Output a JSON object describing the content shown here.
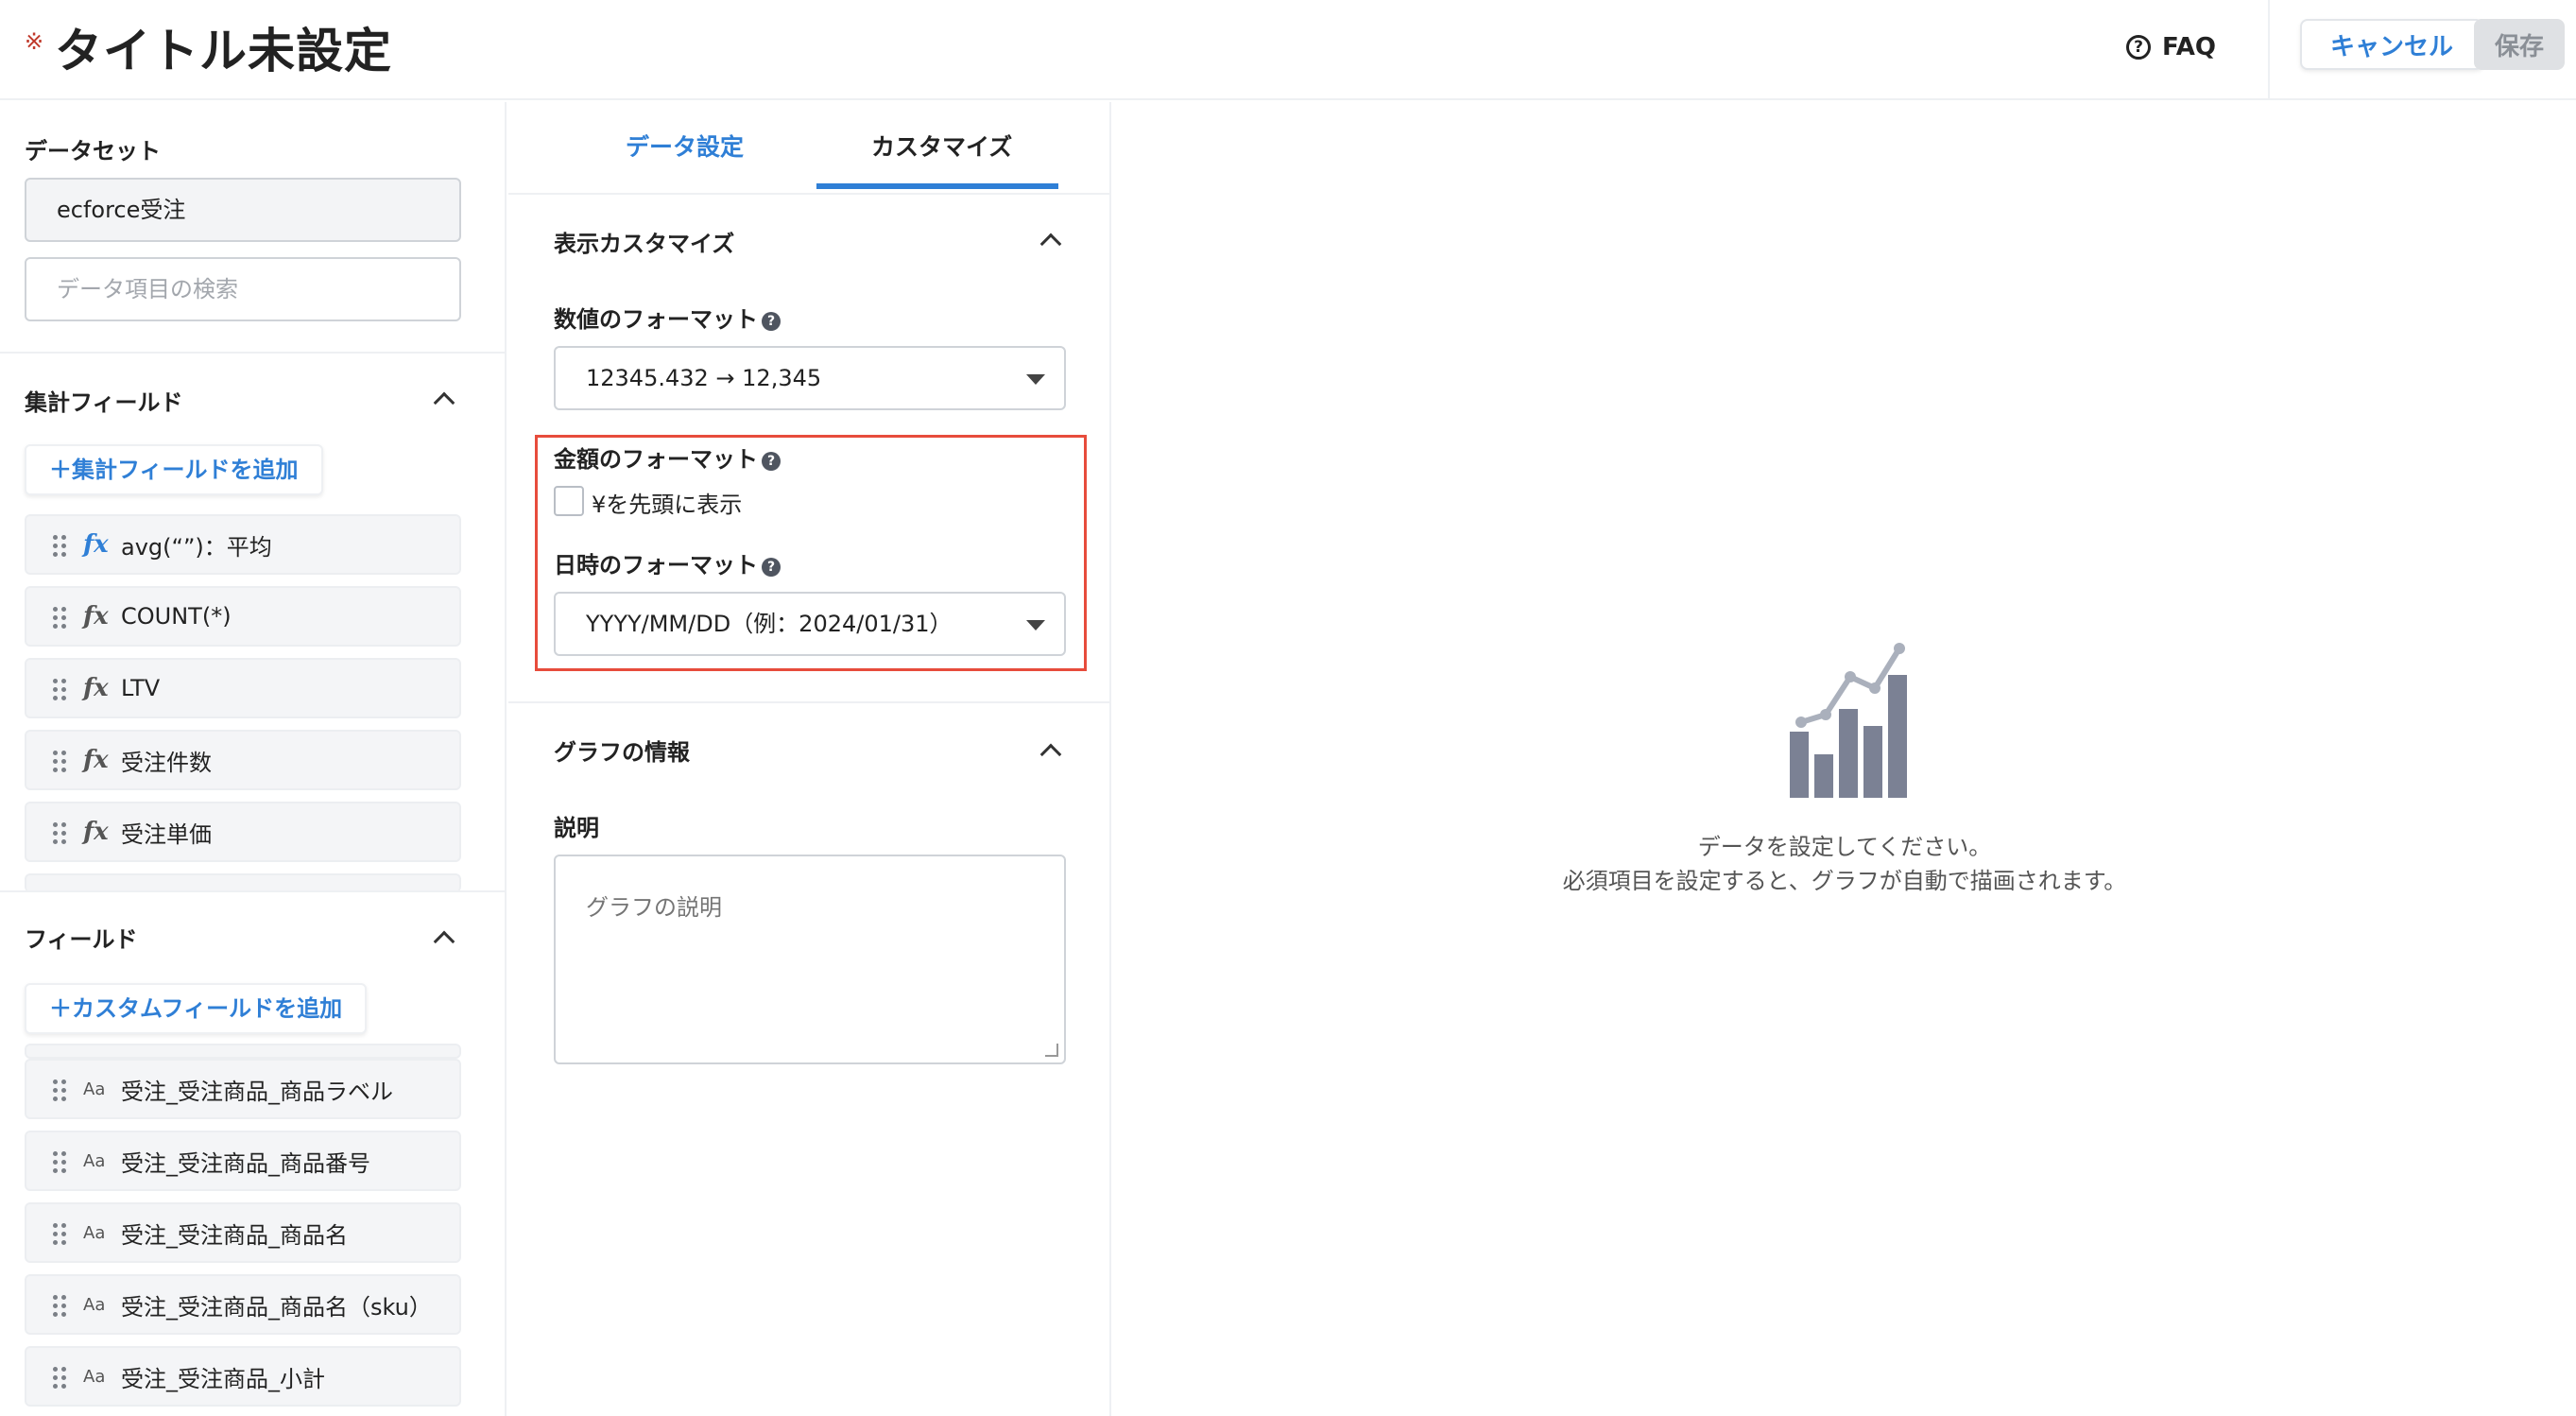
{
  "header": {
    "title_mark": "※",
    "title": "タイトル未設定",
    "faq_label": "FAQ",
    "cancel_label": "キャンセル",
    "save_label": "保存"
  },
  "left": {
    "dataset_label": "データセット",
    "dataset_value": "ecforce受注",
    "search_placeholder": "データ項目の検索",
    "aggregate_section": {
      "title": "集計フィールド",
      "add_label": "＋集計フィールドを追加",
      "items": [
        {
          "label": "avg(“”)：平均",
          "icon": "fx"
        },
        {
          "label": "COUNT(*)",
          "icon": "fx"
        },
        {
          "label": "LTV",
          "icon": "fx"
        },
        {
          "label": "受注件数",
          "icon": "fx"
        },
        {
          "label": "受注単価",
          "icon": "fx"
        }
      ]
    },
    "field_section": {
      "title": "フィールド",
      "add_label": "＋カスタムフィールドを追加",
      "items": [
        {
          "label": "受注_受注商品_商品ラベル",
          "icon": "Aa"
        },
        {
          "label": "受注_受注商品_商品番号",
          "icon": "Aa"
        },
        {
          "label": "受注_受注商品_商品名",
          "icon": "Aa"
        },
        {
          "label": "受注_受注商品_商品名（sku）",
          "icon": "Aa"
        },
        {
          "label": "受注_受注商品_小計",
          "icon": "Aa"
        }
      ]
    }
  },
  "mid": {
    "tabs": [
      {
        "label": "データ設定",
        "active": false
      },
      {
        "label": "カスタマイズ",
        "active": true
      }
    ],
    "display_section": {
      "title": "表示カスタマイズ",
      "number_format_label": "数値のフォーマット",
      "number_format_value": "12345.432 → 12,345",
      "currency_format_label": "金額のフォーマット",
      "currency_checkbox_label": "¥を先頭に表示",
      "currency_checked": false,
      "date_format_label": "日時のフォーマット",
      "date_format_value": "YYYY/MM/DD（例：2024/01/31）",
      "help_icon": "?"
    },
    "graph_section": {
      "title": "グラフの情報",
      "description_label": "説明",
      "description_placeholder": "グラフの説明"
    }
  },
  "empty_state": {
    "line1": "データを設定してください。",
    "line2": "必須項目を設定すると、グラフが自動で描画されます。",
    "icon": "chart-placeholder-icon"
  },
  "colors": {
    "accent": "#2f7fd6",
    "highlight": "#e74c3c",
    "icon_gray": "#7b8194"
  }
}
